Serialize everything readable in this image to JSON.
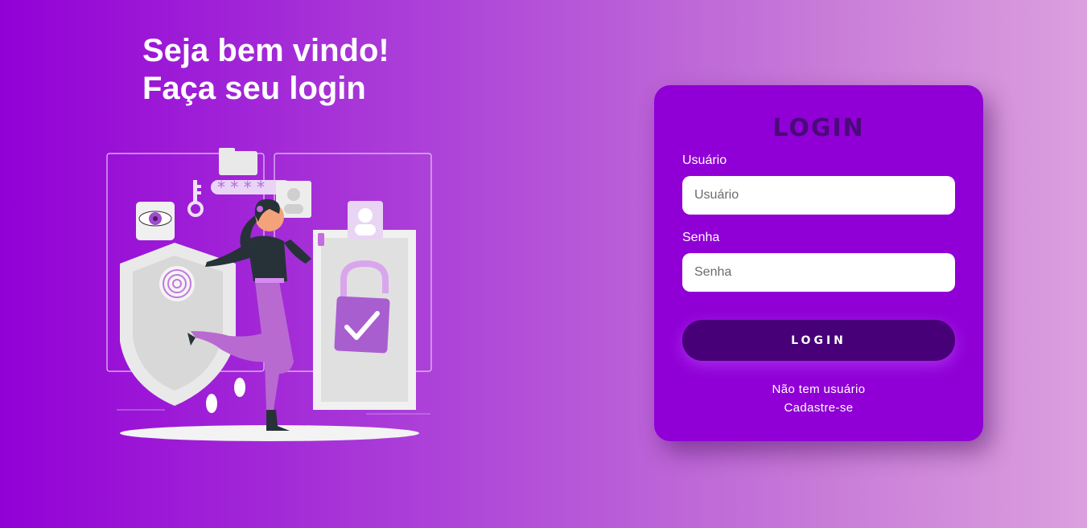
{
  "welcome": {
    "line1": "Seja bem vindo!",
    "line2": "Faça seu login"
  },
  "login_card": {
    "title": "LOGIN",
    "username": {
      "label": "Usuário",
      "placeholder": "Usuário",
      "value": ""
    },
    "password": {
      "label": "Senha",
      "placeholder": "Senha",
      "value": ""
    },
    "submit_label": "LOGIN",
    "no_user_text": "Não tem usuário",
    "signup_link": "Cadastre-se"
  },
  "colors": {
    "background_start": "#9200d6",
    "background_end": "#dc9fde",
    "card": "#9000d6",
    "button": "#470077",
    "title": "#4a0a78"
  },
  "illustration": {
    "icon": "security-login-illustration"
  }
}
